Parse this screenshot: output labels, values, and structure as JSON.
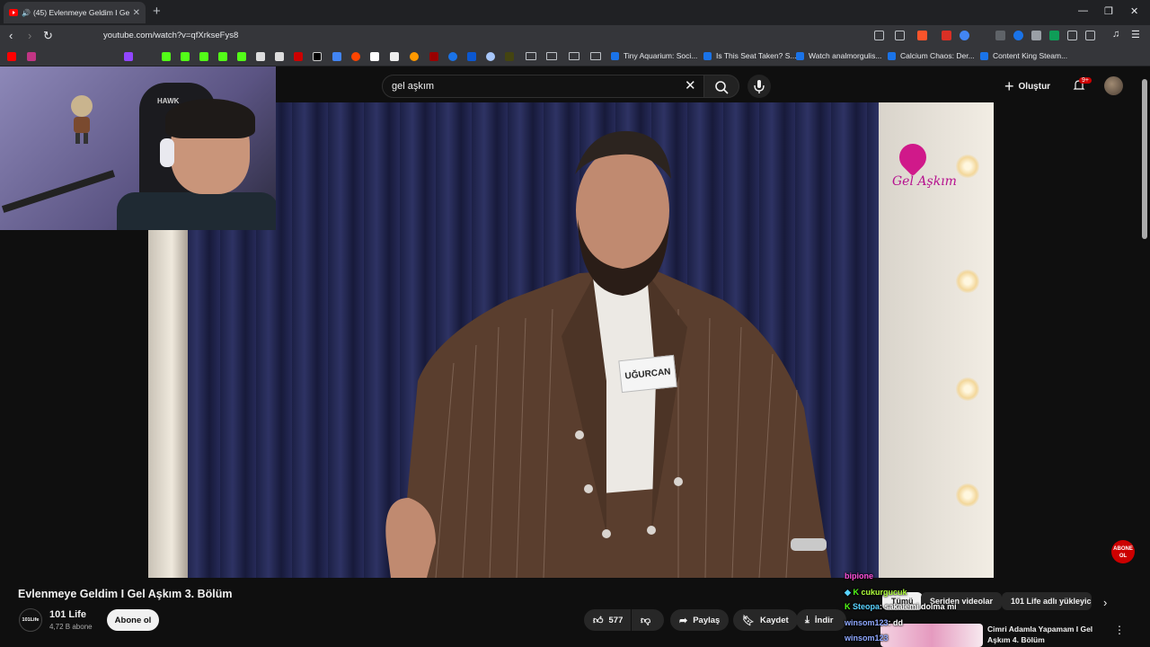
{
  "browser": {
    "tab_title": "(45) Evlenmeye Geldim I Gel A",
    "url": "youtube.com/watch?v=qfXrkseFys8",
    "bookmarks": [
      {
        "label": "Tiny Aquarium: Soci..."
      },
      {
        "label": "Is This Seat Taken? S..."
      },
      {
        "label": "Watch analmorgulis..."
      },
      {
        "label": "Calcium Chaos: Der..."
      },
      {
        "label": "Content King Steam..."
      }
    ]
  },
  "header": {
    "search_value": "gel aşkım",
    "create_label": "Oluştur",
    "notif_badge": "9+"
  },
  "video": {
    "logo_text": "Gel Aşkım",
    "nametag": "UĞURCAN",
    "subscribe_overlay": "ABONE OL",
    "webcam_chair_text": "HAWK"
  },
  "info": {
    "title": "Evlenmeye Geldim I Gel Aşkım 3. Bölüm",
    "channel_name": "101 Life",
    "channel_avatar_text": "101Life",
    "subscribers": "4,72 B abone",
    "subscribe_label": "Abone ol",
    "like_count": "577",
    "share_label": "Paylaş",
    "save_label": "Kaydet",
    "download_label": "İndir"
  },
  "sidebar": {
    "chips": [
      {
        "label": "Tümü",
        "active": true
      },
      {
        "label": "Seriden videolar",
        "active": false
      },
      {
        "label": "101 Life adlı yükleyic",
        "active": false
      }
    ],
    "rec_title": "Cimri Adamla Yapamam I Gel Aşkım 4. Bölüm"
  },
  "chat": [
    {
      "user": "bipione",
      "text": "",
      "color": "#ff4fd8"
    },
    {
      "user": "cukurgucuk",
      "text": "",
      "color": "#b0ff3c"
    },
    {
      "user": "Steopa",
      "text": "sakalemi dolma mi",
      "color": "#59d3ff"
    },
    {
      "user": "winsom123",
      "text": "dd",
      "color": "#8fa8ff"
    },
    {
      "user": "winsom123",
      "text": "",
      "color": "#8fa8ff"
    }
  ],
  "colors": {
    "yt_red": "#ff0000",
    "bg": "#0f0f0f",
    "pill": "#272727"
  }
}
